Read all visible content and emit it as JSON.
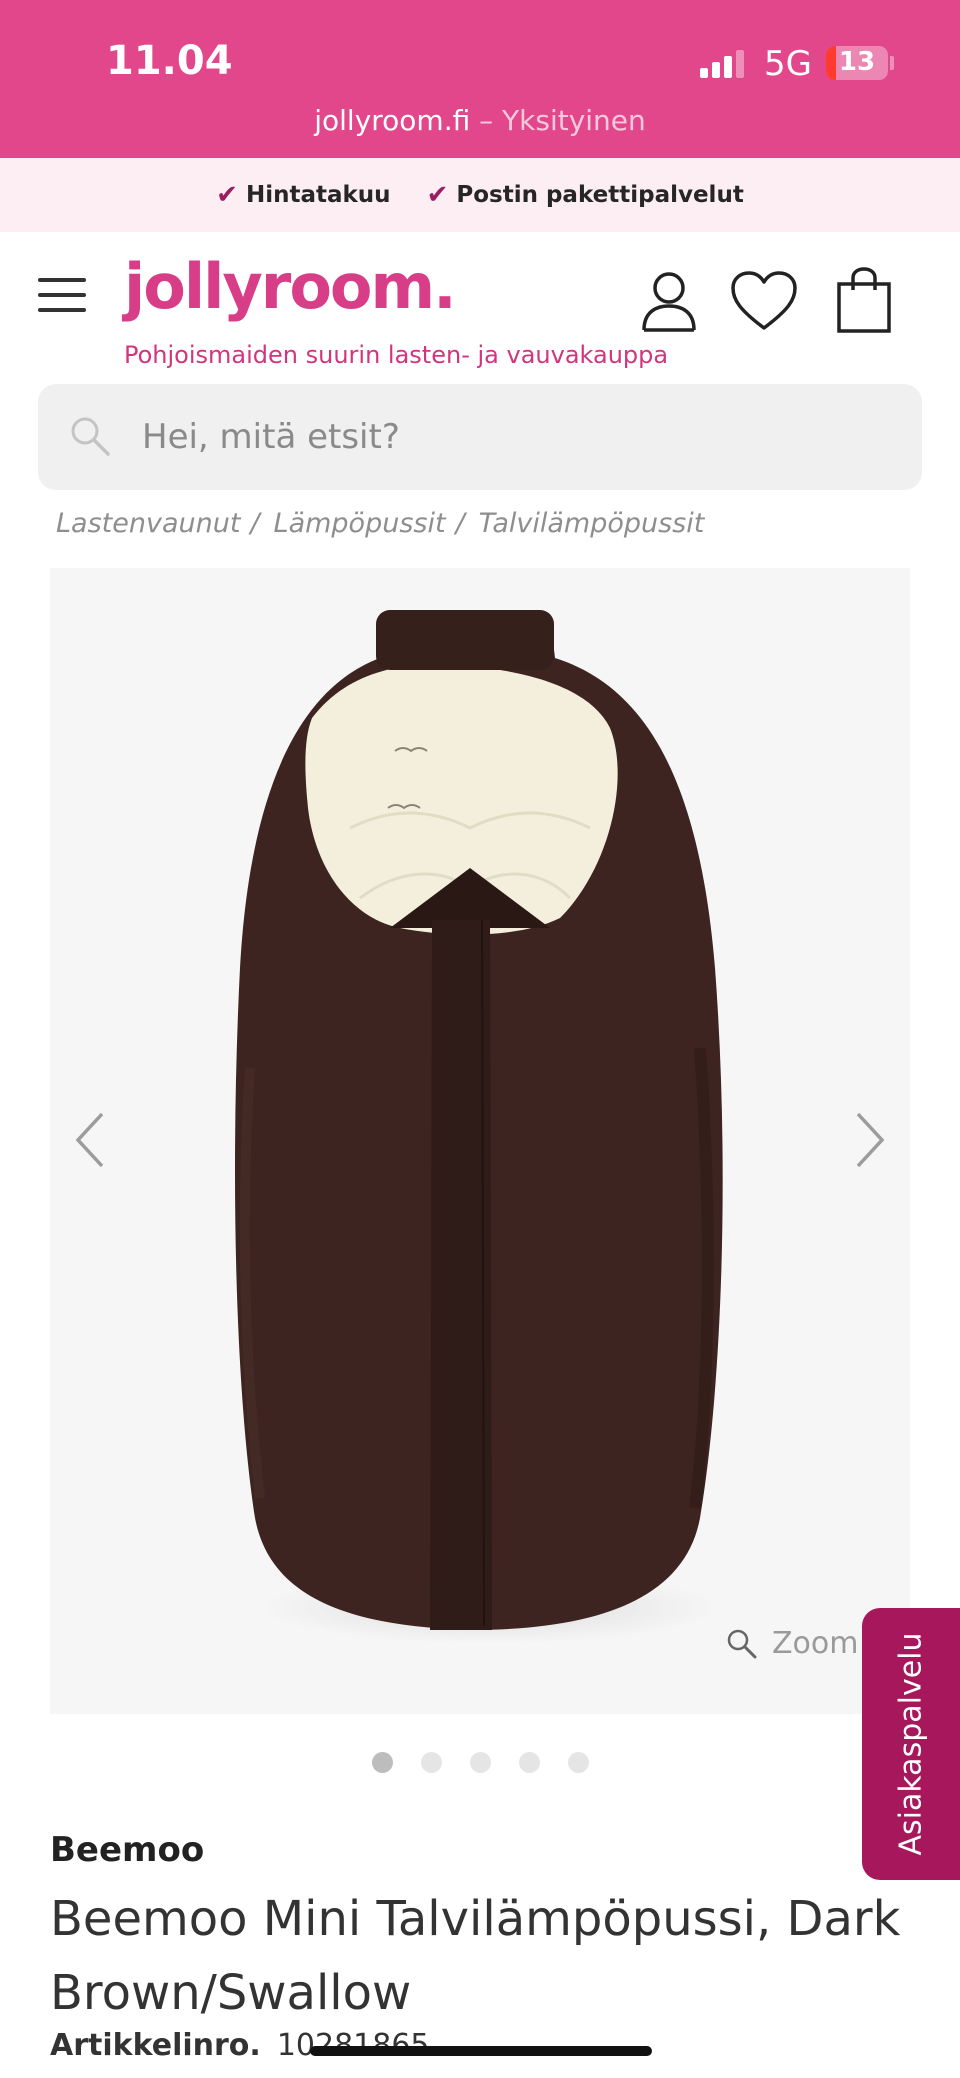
{
  "status_bar": {
    "time": "11.04",
    "network": "5G",
    "battery": "13",
    "url_domain": "jollyroom.fi",
    "url_mode": " – Yksityinen"
  },
  "usp": {
    "items": [
      "Hintatakuu",
      "Postin pakettipalvelut"
    ]
  },
  "header": {
    "logo": "jollyroom.",
    "tagline": "Pohjoismaiden suurin lasten- ja vauvakauppa"
  },
  "search": {
    "placeholder": "Hei, mitä etsit?"
  },
  "breadcrumb": {
    "items": [
      "Lastenvaunut",
      "Lämpöpussit",
      "Talvilämpöpussit"
    ],
    "separator": "/"
  },
  "gallery": {
    "zoom_label": "Zoom",
    "dot_count": 5,
    "active_dot": 0
  },
  "customer_service": {
    "label": "Asiakaspalvelu"
  },
  "product": {
    "brand": "Beemoo",
    "title": "Beemoo Mini Talvilämpöpussi, Dark Brown/Swallow",
    "article_label": "Artikkelinro.",
    "article_number": "10281865"
  },
  "colors": {
    "brand_pink": "#e2478b",
    "logo_pink": "#d83e88",
    "service_tab": "#a6185b",
    "bag_brown": "#3d2420"
  }
}
